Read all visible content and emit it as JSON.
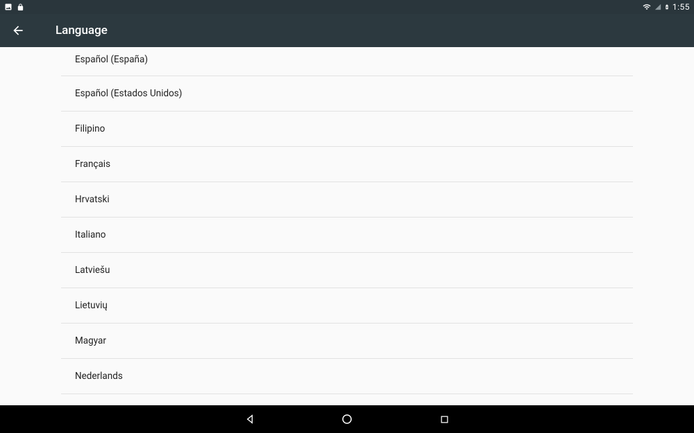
{
  "status": {
    "time": "1:55"
  },
  "header": {
    "title": "Language"
  },
  "languages": [
    "Español (España)",
    "Español (Estados Unidos)",
    "Filipino",
    "Français",
    "Hrvatski",
    "Italiano",
    "Latviešu",
    "Lietuvių",
    "Magyar",
    "Nederlands"
  ]
}
